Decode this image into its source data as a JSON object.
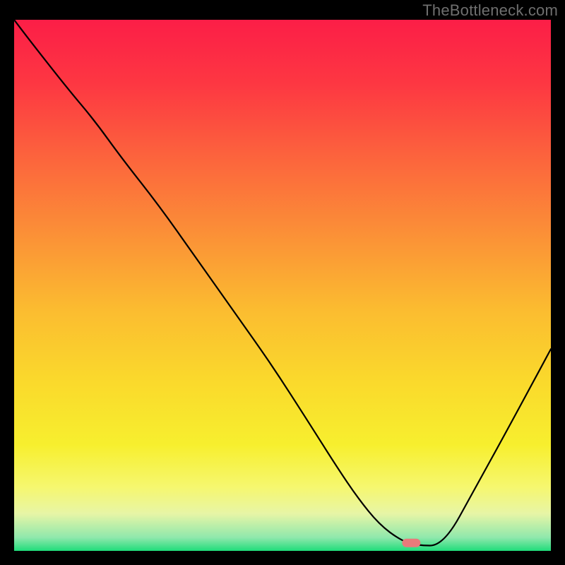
{
  "watermark": "TheBottleneck.com",
  "chart_data": {
    "type": "line",
    "title": "",
    "xlabel": "",
    "ylabel": "",
    "xlim": [
      0,
      100
    ],
    "ylim": [
      0,
      100
    ],
    "grid": false,
    "legend": false,
    "series": [
      {
        "name": "bottleneck-curve",
        "x": [
          0,
          3,
          10,
          15,
          20,
          27,
          34,
          41,
          48,
          55,
          60,
          64,
          68,
          72,
          75,
          80,
          86,
          92,
          100
        ],
        "y": [
          100,
          96,
          87,
          81,
          74,
          65,
          55,
          45,
          35,
          24,
          16,
          10,
          5,
          2,
          1,
          1,
          12,
          23,
          38
        ]
      }
    ],
    "marker": {
      "name": "current-config",
      "x": 74,
      "y": 1.5,
      "color": "#e97a7b",
      "shape": "capsule"
    },
    "background": {
      "type": "vertical-gradient",
      "stops": [
        {
          "pos": 0.0,
          "color": "#fc1e47"
        },
        {
          "pos": 0.12,
          "color": "#fd3742"
        },
        {
          "pos": 0.25,
          "color": "#fc613d"
        },
        {
          "pos": 0.4,
          "color": "#fb8f37"
        },
        {
          "pos": 0.55,
          "color": "#fbbd30"
        },
        {
          "pos": 0.68,
          "color": "#fad92c"
        },
        {
          "pos": 0.8,
          "color": "#f7ef2e"
        },
        {
          "pos": 0.88,
          "color": "#f6f76f"
        },
        {
          "pos": 0.93,
          "color": "#e7f5a6"
        },
        {
          "pos": 0.975,
          "color": "#8fe8ac"
        },
        {
          "pos": 1.0,
          "color": "#1fdc7a"
        }
      ]
    }
  }
}
